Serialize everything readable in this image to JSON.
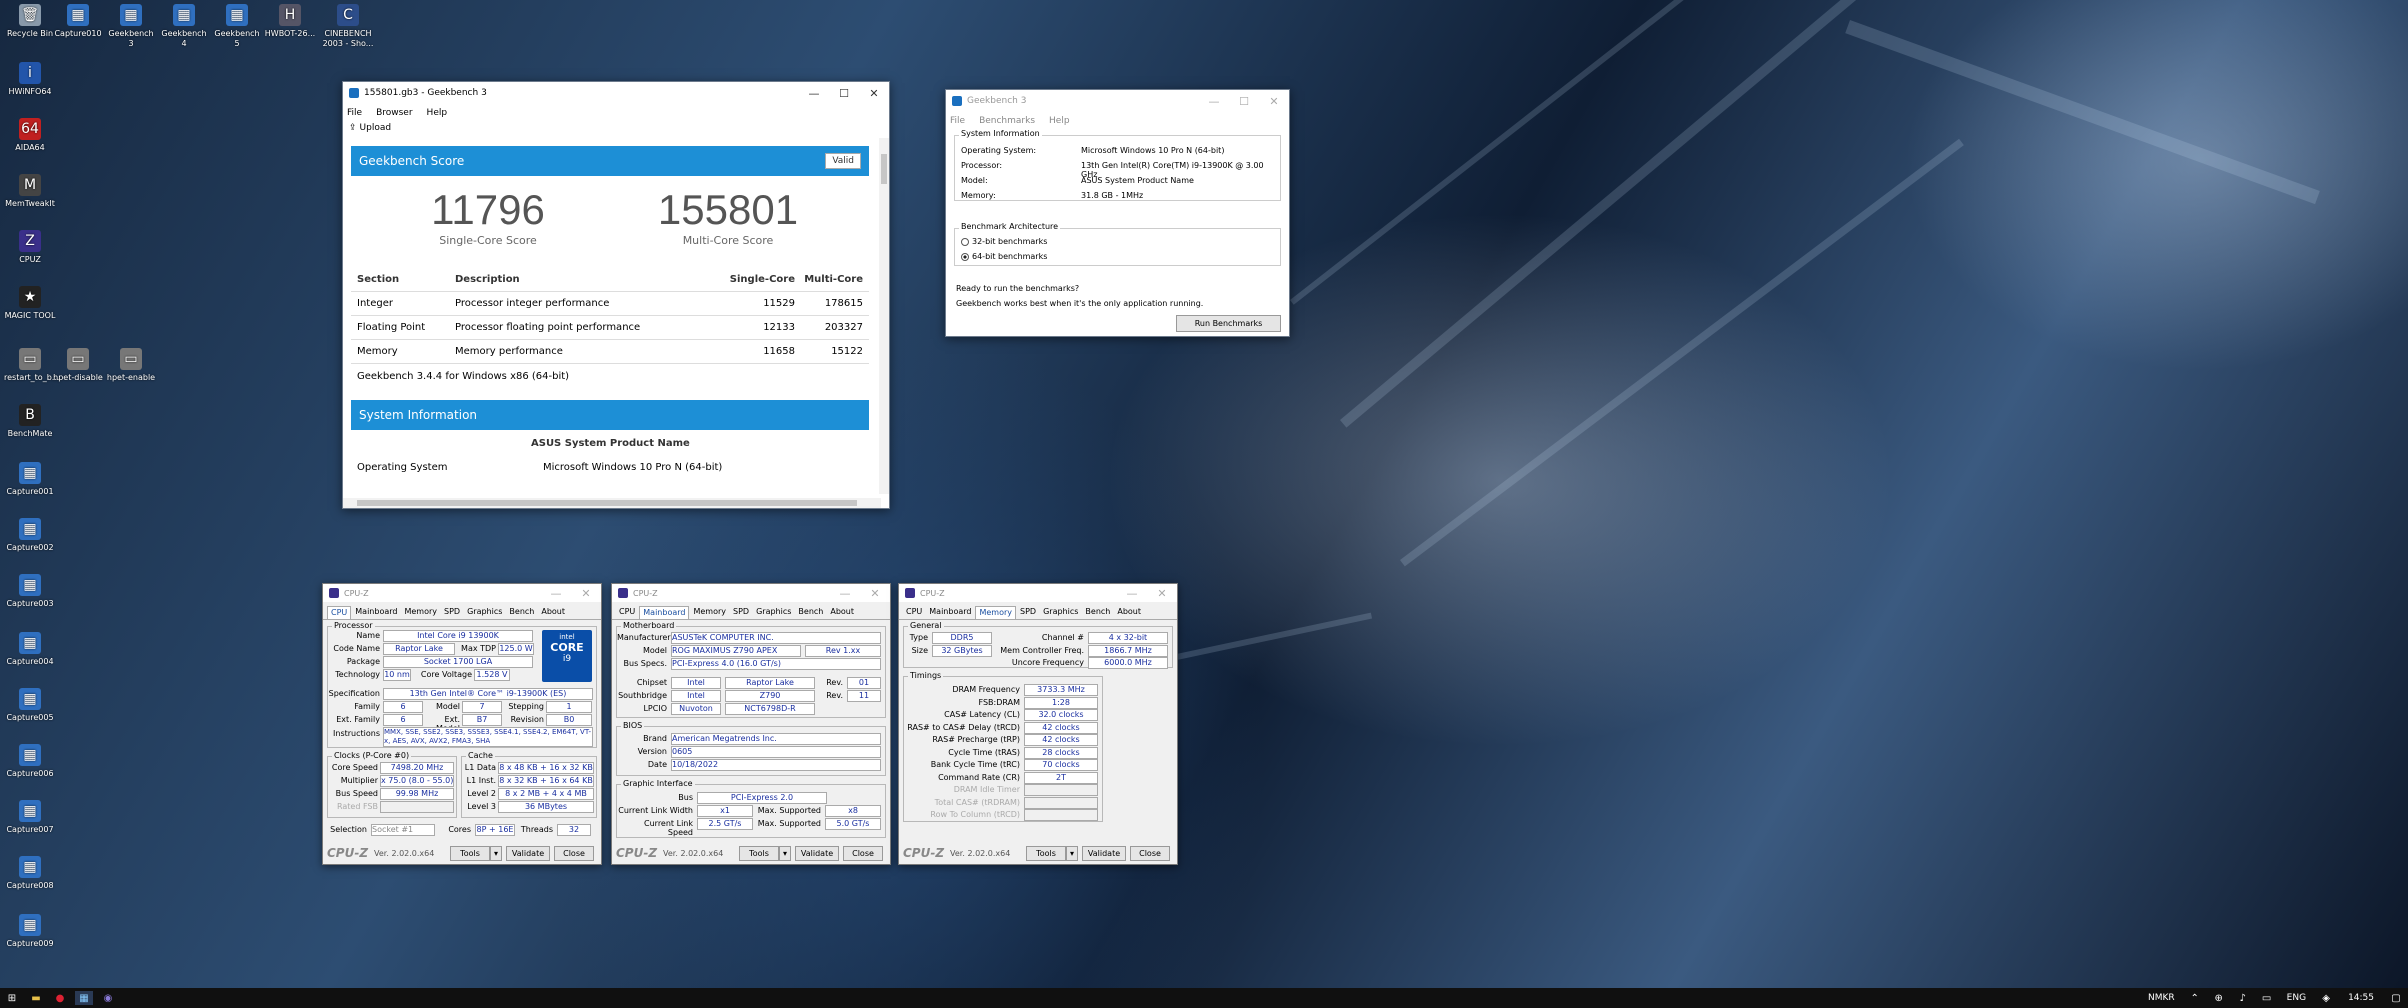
{
  "desktop": {
    "icons": [
      {
        "label": "Recycle Bin",
        "glyph": "🗑",
        "c": "#8899aa"
      },
      {
        "label": "Capture010",
        "glyph": "▦",
        "c": "#2f6fbf"
      },
      {
        "label": "Geekbench 3",
        "glyph": "▦",
        "c": "#2f6fbf"
      },
      {
        "label": "Geekbench 4",
        "glyph": "▦",
        "c": "#2f6fbf"
      },
      {
        "label": "Geekbench 5",
        "glyph": "▦",
        "c": "#2f6fbf"
      },
      {
        "label": "HWBOT-26...",
        "glyph": "H",
        "c": "#556"
      },
      {
        "label": "CINEBENCH 2003 - Sho...",
        "glyph": "C",
        "c": "#2c4d8a"
      },
      {
        "label": "HWiNFO64",
        "glyph": "i",
        "c": "#2255aa"
      },
      {
        "label": "AIDA64",
        "glyph": "64",
        "c": "#c02020"
      },
      {
        "label": "MemTweakIt",
        "glyph": "M",
        "c": "#444"
      },
      {
        "label": "CPUZ",
        "glyph": "Z",
        "c": "#3a2f8a"
      },
      {
        "label": "MAGIC TOOL",
        "glyph": "★",
        "c": "#222"
      },
      {
        "label": "restart_to_b...",
        "glyph": "▭",
        "c": "#777"
      },
      {
        "label": "hpet-disable",
        "glyph": "▭",
        "c": "#777"
      },
      {
        "label": "hpet-enable",
        "glyph": "▭",
        "c": "#777"
      },
      {
        "label": "BenchMate",
        "glyph": "B",
        "c": "#222"
      },
      {
        "label": "Capture001",
        "glyph": "▦",
        "c": "#2f6fbf"
      },
      {
        "label": "Capture002",
        "glyph": "▦",
        "c": "#2f6fbf"
      },
      {
        "label": "Capture003",
        "glyph": "▦",
        "c": "#2f6fbf"
      },
      {
        "label": "Capture004",
        "glyph": "▦",
        "c": "#2f6fbf"
      },
      {
        "label": "Capture005",
        "glyph": "▦",
        "c": "#2f6fbf"
      },
      {
        "label": "Capture006",
        "glyph": "▦",
        "c": "#2f6fbf"
      },
      {
        "label": "Capture007",
        "glyph": "▦",
        "c": "#2f6fbf"
      },
      {
        "label": "Capture008",
        "glyph": "▦",
        "c": "#2f6fbf"
      },
      {
        "label": "Capture009",
        "glyph": "▦",
        "c": "#2f6fbf"
      }
    ]
  },
  "gb_result": {
    "title": "155801.gb3 - Geekbench 3",
    "menu": [
      "File",
      "Browser",
      "Help"
    ],
    "upload": "Upload",
    "score_header": "Geekbench Score",
    "valid": "Valid",
    "single": "11796",
    "single_label": "Single-Core Score",
    "multi": "155801",
    "multi_label": "Multi-Core Score",
    "headers": [
      "Section",
      "Description",
      "Single-Core",
      "Multi-Core"
    ],
    "rows": [
      [
        "Integer",
        "Processor integer performance",
        "11529",
        "178615"
      ],
      [
        "Floating Point",
        "Processor floating point performance",
        "12133",
        "203327"
      ],
      [
        "Memory",
        "Memory performance",
        "11658",
        "15122"
      ]
    ],
    "version_note": "Geekbench 3.4.4 for Windows x86 (64-bit)",
    "sys_header": "System Information",
    "sys_name": "ASUS System Product Name",
    "os_label": "Operating System",
    "os_value": "Microsoft Windows 10 Pro N (64-bit)"
  },
  "gb_app": {
    "title": "Geekbench 3",
    "menu": [
      "File",
      "Benchmarks",
      "Help"
    ],
    "sys_group": "System Information",
    "fields": [
      [
        "Operating System:",
        "Microsoft Windows 10 Pro N (64-bit)"
      ],
      [
        "Processor:",
        "13th Gen Intel(R) Core(TM) i9-13900K @ 3.00 GHz"
      ],
      [
        "Model:",
        "ASUS System Product Name"
      ],
      [
        "Memory:",
        "31.8 GB - 1MHz"
      ]
    ],
    "arch_group": "Benchmark Architecture",
    "opt32": "32-bit benchmarks",
    "opt64": "64-bit benchmarks",
    "ready": "Ready to run the benchmarks?",
    "hint": "Geekbench works best when it's the only application running.",
    "run": "Run Benchmarks"
  },
  "cpuz_common": {
    "title": "CPU-Z",
    "tabs": [
      "CPU",
      "Mainboard",
      "Memory",
      "SPD",
      "Graphics",
      "Bench",
      "About"
    ],
    "logo": "CPU-Z",
    "version": "Ver. 2.02.0.x64",
    "tools": "Tools",
    "validate": "Validate",
    "close": "Close"
  },
  "cpuz_cpu": {
    "processor": "Processor",
    "name_l": "Name",
    "name": "Intel Core i9 13900K",
    "codename_l": "Code Name",
    "codename": "Raptor Lake",
    "maxtdp_l": "Max TDP",
    "maxtdp": "125.0 W",
    "package_l": "Package",
    "package": "Socket 1700 LGA",
    "tech_l": "Technology",
    "tech": "10 nm",
    "cv_l": "Core Voltage",
    "cv": "1.528 V",
    "spec_l": "Specification",
    "spec": "13th Gen Intel® Core™ i9-13900K (ES)",
    "family_l": "Family",
    "family": "6",
    "model_l": "Model",
    "model": "7",
    "stepping_l": "Stepping",
    "stepping": "1",
    "extfam_l": "Ext. Family",
    "extfam": "6",
    "extmod_l": "Ext. Model",
    "extmod": "B7",
    "rev_l": "Revision",
    "rev": "B0",
    "instr_l": "Instructions",
    "instr": "MMX, SSE, SSE2, SSE3, SSSE3, SSE4.1, SSE4.2, EM64T, VT-x, AES, AVX, AVX2, FMA3, SHA",
    "clocks": "Clocks (P-Core #0)",
    "cache": "Cache",
    "cs_l": "Core Speed",
    "cs": "7498.20 MHz",
    "mult_l": "Multiplier",
    "mult": "x 75.0 (8.0 - 55.0)",
    "bus_l": "Bus Speed",
    "bus": "99.98 MHz",
    "fsb_l": "Rated FSB",
    "l1d_l": "L1 Data",
    "l1d": "8 x 48 KB + 16 x 32 KB",
    "l1i_l": "L1 Inst.",
    "l1i": "8 x 32 KB + 16 x 64 KB",
    "l2_l": "Level 2",
    "l2": "8 x 2 MB + 4 x 4 MB",
    "l3_l": "Level 3",
    "l3": "36 MBytes",
    "sel_l": "Selection",
    "sel": "Socket #1",
    "cores_l": "Cores",
    "cores": "8P + 16E",
    "threads_l": "Threads",
    "threads": "32",
    "badge_top": "intel",
    "badge_mid": "CORE",
    "badge_bot": "i9"
  },
  "cpuz_mb": {
    "mb": "Motherboard",
    "manu_l": "Manufacturer",
    "manu": "ASUSTeK COMPUTER INC.",
    "model_l": "Model",
    "model": "ROG MAXIMUS Z790 APEX",
    "rev": "Rev 1.xx",
    "busspec_l": "Bus Specs.",
    "busspec": "PCI-Express 4.0 (16.0 GT/s)",
    "chip_l": "Chipset",
    "chip_v": "Intel",
    "chip_n": "Raptor Lake",
    "rev_l": "Rev.",
    "chip_r": "01",
    "sb_l": "Southbridge",
    "sb_v": "Intel",
    "sb_n": "Z790",
    "sb_r": "11",
    "lpc_l": "LPCIO",
    "lpc_v": "Nuvoton",
    "lpc_n": "NCT6798D-R",
    "bios": "BIOS",
    "brand_l": "Brand",
    "brand": "American Megatrends Inc.",
    "ver_l": "Version",
    "ver": "0605",
    "date_l": "Date",
    "date": "10/18/2022",
    "gi": "Graphic Interface",
    "gbus_l": "Bus",
    "gbus": "PCI-Express 2.0",
    "clw_l": "Current Link Width",
    "clw": "x1",
    "ms_l": "Max. Supported",
    "msw": "x8",
    "cls_l": "Current Link Speed",
    "cls": "2.5 GT/s",
    "mss": "5.0 GT/s"
  },
  "cpuz_mem": {
    "general": "General",
    "type_l": "Type",
    "type": "DDR5",
    "ch_l": "Channel #",
    "ch": "4 x 32-bit",
    "size_l": "Size",
    "size": "32 GBytes",
    "mcf_l": "Mem Controller Freq.",
    "mcf": "1866.7 MHz",
    "ucf_l": "Uncore Frequency",
    "ucf": "6000.0 MHz",
    "timings": "Timings",
    "t": [
      [
        "DRAM Frequency",
        "3733.3 MHz"
      ],
      [
        "FSB:DRAM",
        "1:28"
      ],
      [
        "CAS# Latency (CL)",
        "32.0 clocks"
      ],
      [
        "RAS# to CAS# Delay (tRCD)",
        "42 clocks"
      ],
      [
        "RAS# Precharge (tRP)",
        "42 clocks"
      ],
      [
        "Cycle Time (tRAS)",
        "28 clocks"
      ],
      [
        "Bank Cycle Time (tRC)",
        "70 clocks"
      ],
      [
        "Command Rate (CR)",
        "2T"
      ],
      [
        "DRAM Idle Timer",
        ""
      ],
      [
        "Total CAS# (tRDRAM)",
        ""
      ],
      [
        "Row To Column (tRCD)",
        ""
      ]
    ]
  },
  "taskbar": {
    "lang": "NMKR",
    "ime": "ENG",
    "time": "14:55"
  }
}
